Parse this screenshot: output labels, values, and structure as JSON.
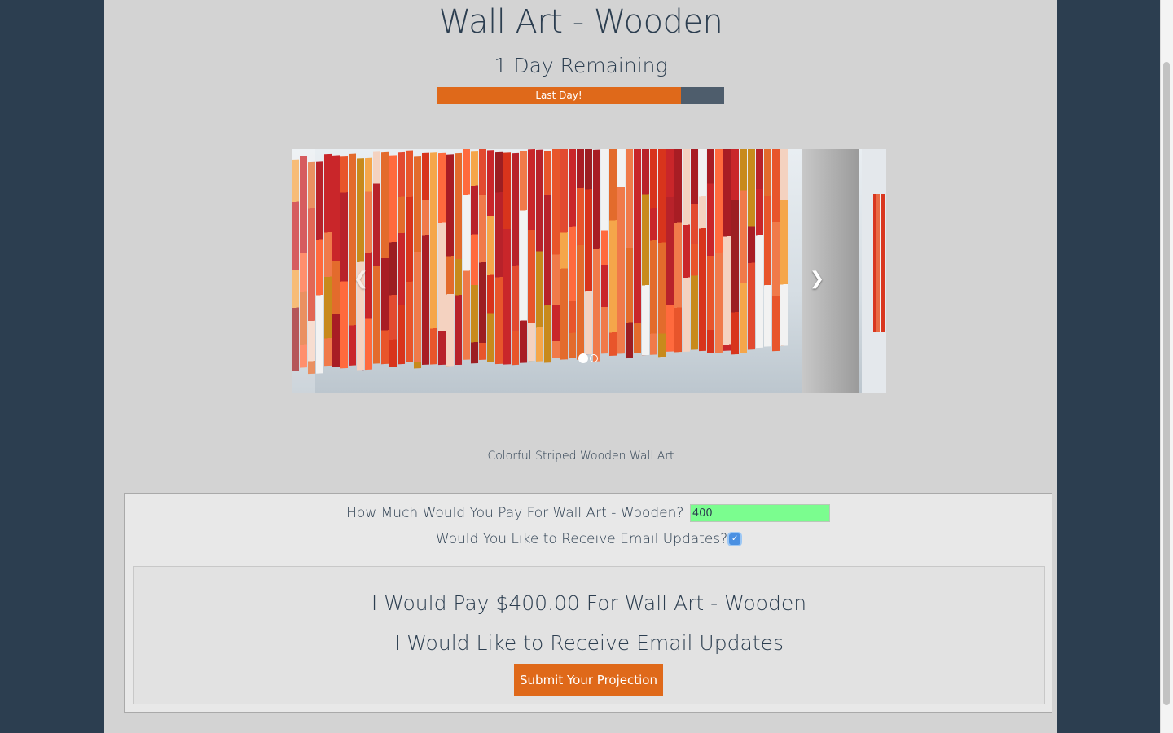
{
  "page": {
    "title": "Wall Art - Wooden",
    "remaining": "1 Day Remaining",
    "progress": {
      "label": "Last Day!",
      "fraction": 0.85
    }
  },
  "carousel": {
    "caption": "Colorful Striped Wooden Wall Art",
    "slide_count": 2,
    "active_index": 0,
    "prev_icon": "chevron-left-icon",
    "next_icon": "chevron-right-icon"
  },
  "form": {
    "price_question": "How Much Would You Pay For Wall Art - Wooden?",
    "price_value": "400",
    "email_question": "Would You Like to Receive Email Updates?",
    "email_checked": true
  },
  "summary": {
    "pay_line": "I Would Pay $400.00 For Wall Art - Wooden",
    "email_line": "I Would Like to Receive Email Updates",
    "submit_label": "Submit Your Projection"
  },
  "colors": {
    "background": "#2c3e50",
    "content": "#d3d3d3",
    "accent": "#df691a",
    "progress_track": "#4e5d6c",
    "input_valid": "#7bfd8f",
    "text": "#2c3e50"
  }
}
